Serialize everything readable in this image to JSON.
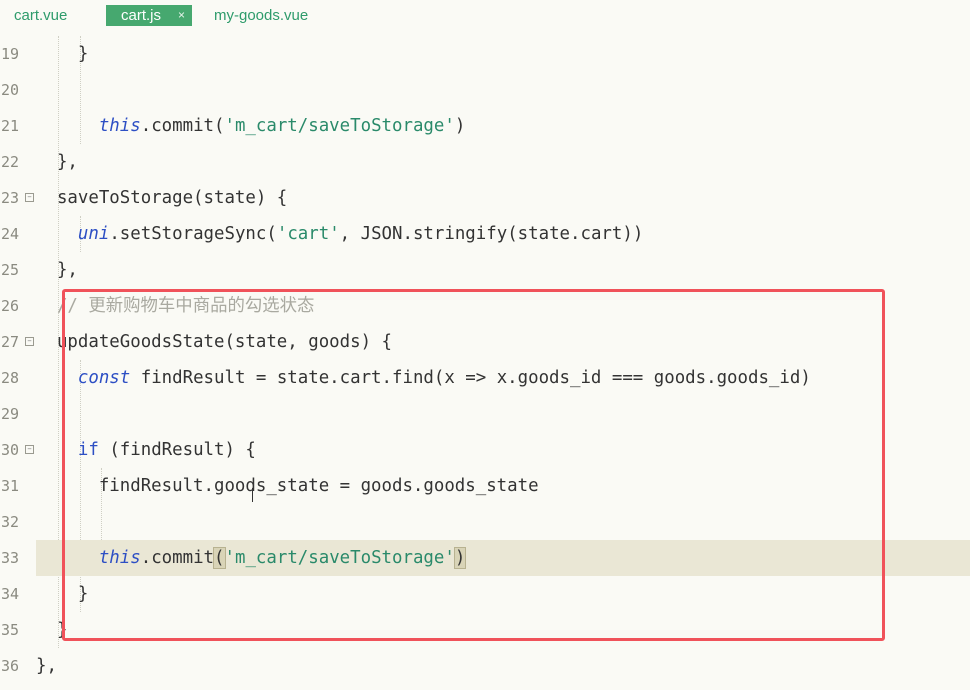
{
  "tabs": [
    {
      "label": "cart.vue",
      "active": false
    },
    {
      "label": "cart.js",
      "active": true,
      "close": "×"
    },
    {
      "label": "my-goods.vue",
      "active": false
    }
  ],
  "lines": [
    {
      "num": "19",
      "fold": false
    },
    {
      "num": "20",
      "fold": false
    },
    {
      "num": "21",
      "fold": false
    },
    {
      "num": "22",
      "fold": false
    },
    {
      "num": "23",
      "fold": true
    },
    {
      "num": "24",
      "fold": false
    },
    {
      "num": "25",
      "fold": false
    },
    {
      "num": "26",
      "fold": false
    },
    {
      "num": "27",
      "fold": true
    },
    {
      "num": "28",
      "fold": false
    },
    {
      "num": "29",
      "fold": false
    },
    {
      "num": "30",
      "fold": true
    },
    {
      "num": "31",
      "fold": false
    },
    {
      "num": "32",
      "fold": false
    },
    {
      "num": "33",
      "fold": false
    },
    {
      "num": "34",
      "fold": false
    },
    {
      "num": "35",
      "fold": false
    },
    {
      "num": "36",
      "fold": false
    }
  ],
  "code": {
    "l19": "    }",
    "l21_kw": "this",
    "l21_a": ".commit(",
    "l21_str": "'m_cart/saveToStorage'",
    "l21_b": ")",
    "l22": "  },",
    "l23": "  saveToStorage(state) {",
    "l24_kw": "uni",
    "l24_a": ".setStorageSync(",
    "l24_str": "'cart'",
    "l24_b": ", JSON.stringify(state.cart))",
    "l25": "  },",
    "l26": "  // 更新购物车中商品的勾选状态",
    "l27": "  updateGoodsState(state, goods) {",
    "l28_kw": "const",
    "l28_a": " findResult = state.cart.find(x => x.goods_id === goods.goods_id)",
    "l30_kw": "if",
    "l30_a": " (findResult) {",
    "l31": "      findResult.goods_state = goods.goods_state",
    "l33_kw": "this",
    "l33_a": ".commit",
    "l33_p1": "(",
    "l33_str": "'m_cart/saveToStorage'",
    "l33_p2": ")",
    "l34": "    }",
    "l35": "  }",
    "l36": "},"
  },
  "fold_glyph": "−"
}
